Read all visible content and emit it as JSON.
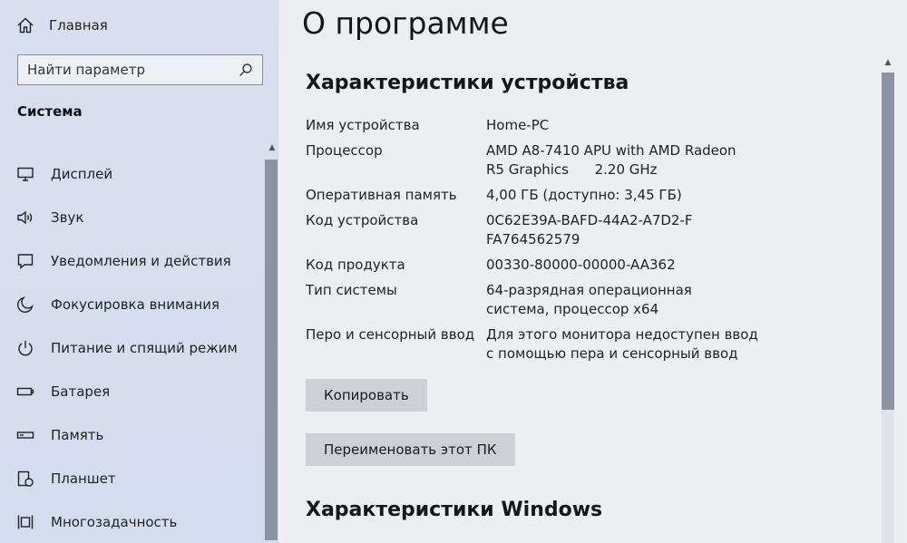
{
  "sidebar": {
    "home_label": "Главная",
    "search_placeholder": "Найти параметр",
    "section_title": "Система",
    "items": [
      {
        "label": "Дисплей",
        "icon": "monitor-icon"
      },
      {
        "label": "Звук",
        "icon": "speaker-icon"
      },
      {
        "label": "Уведомления и действия",
        "icon": "notification-icon"
      },
      {
        "label": "Фокусировка внимания",
        "icon": "moon-icon"
      },
      {
        "label": "Питание и спящий режим",
        "icon": "power-icon"
      },
      {
        "label": "Батарея",
        "icon": "battery-icon"
      },
      {
        "label": "Память",
        "icon": "storage-icon"
      },
      {
        "label": "Планшет",
        "icon": "tablet-icon"
      },
      {
        "label": "Многозадачность",
        "icon": "multitasking-icon"
      }
    ]
  },
  "main": {
    "title": "О программе",
    "device_section_title": "Характеристики устройства",
    "specs": [
      {
        "label": "Имя устройства",
        "value": "Home-PC"
      },
      {
        "label": "Процессор",
        "value": "AMD A8-7410 APU with AMD Radeon R5 Graphics      2.20 GHz"
      },
      {
        "label": "Оперативная память",
        "value": "4,00 ГБ (доступно: 3,45 ГБ)"
      },
      {
        "label": "Код устройства",
        "value": "0C62E39A-BAFD-44A2-A7D2-FFA764562579"
      },
      {
        "label": "Код продукта",
        "value": "00330-80000-00000-AA362"
      },
      {
        "label": "Тип системы",
        "value": "64-разрядная операционная система, процессор x64"
      },
      {
        "label": "Перо и сенсорный ввод",
        "value": "Для этого монитора недоступен ввод с помощью пера и сенсорный ввод"
      }
    ],
    "copy_button": "Копировать",
    "rename_button": "Переименовать этот ПК",
    "windows_section_title": "Характеристики Windows"
  }
}
